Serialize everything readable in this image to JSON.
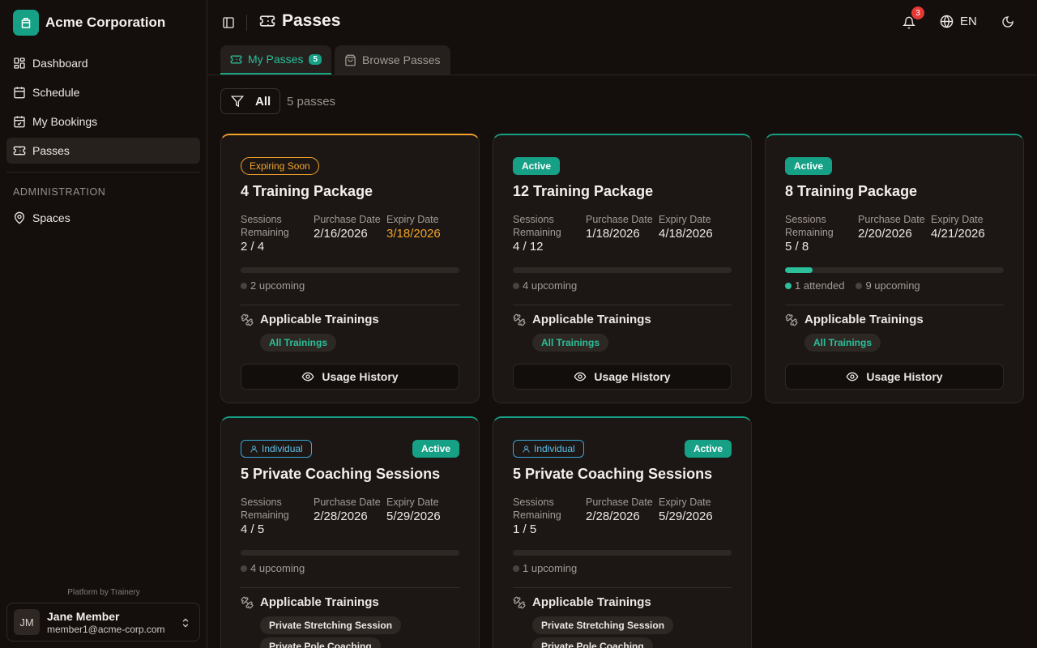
{
  "org": {
    "name": "Acme Corporation"
  },
  "nav": {
    "items": [
      {
        "label": "Dashboard",
        "icon": "dashboard-icon"
      },
      {
        "label": "Schedule",
        "icon": "calendar-icon"
      },
      {
        "label": "My Bookings",
        "icon": "calendar-check-icon"
      },
      {
        "label": "Passes",
        "icon": "ticket-icon",
        "active": true
      }
    ],
    "admin_label": "ADMINISTRATION",
    "admin_items": [
      {
        "label": "Spaces",
        "icon": "map-pin-icon"
      }
    ]
  },
  "footer": {
    "powered": "Platform by Trainery",
    "user_initials": "JM",
    "user_name": "Jane Member",
    "user_email": "member1@acme-corp.com"
  },
  "header": {
    "title": "Passes",
    "notifications": "3",
    "language": "EN"
  },
  "tabs": [
    {
      "label": "My Passes",
      "count": "5",
      "active": true
    },
    {
      "label": "Browse Passes",
      "active": false
    }
  ],
  "filter": {
    "label": "All",
    "count_text": "5 passes"
  },
  "labels": {
    "sessions_remaining": "Sessions Remaining",
    "purchase_date": "Purchase Date",
    "expiry_date": "Expiry Date",
    "applicable_trainings": "Applicable Trainings",
    "usage_history": "Usage History"
  },
  "colors": {
    "accent": "#16a085",
    "warning": "#f2a32a",
    "info": "#3aa5d9",
    "danger": "#e53935"
  },
  "passes": [
    {
      "badge": "Expiring Soon",
      "title": "4 Training Package",
      "sessions": "2 / 4",
      "purchase": "2/16/2026",
      "expiry": "3/18/2026",
      "attended_fraction": 0,
      "upcoming": "2 upcoming",
      "chips": [
        "All Trainings"
      ]
    },
    {
      "badge": "Active",
      "title": "12 Training Package",
      "sessions": "4 / 12",
      "purchase": "1/18/2026",
      "expiry": "4/18/2026",
      "attended_fraction": 0,
      "upcoming": "4 upcoming",
      "chips": [
        "All Trainings"
      ]
    },
    {
      "badge": "Active",
      "title": "8 Training Package",
      "sessions": "5 / 8",
      "purchase": "2/20/2026",
      "expiry": "4/21/2026",
      "attended_fraction": 0.125,
      "attended": "1 attended",
      "upcoming": "9 upcoming",
      "chips": [
        "All Trainings"
      ]
    },
    {
      "type": "Individual",
      "badge": "Active",
      "title": "5 Private Coaching Sessions",
      "sessions": "4 / 5",
      "purchase": "2/28/2026",
      "expiry": "5/29/2026",
      "attended_fraction": 0,
      "upcoming": "4 upcoming",
      "chips": [
        "Private Stretching Session",
        "Private Pole Coaching"
      ]
    },
    {
      "type": "Individual",
      "badge": "Active",
      "title": "5 Private Coaching Sessions",
      "sessions": "1 / 5",
      "purchase": "2/28/2026",
      "expiry": "5/29/2026",
      "attended_fraction": 0,
      "upcoming": "1 upcoming",
      "chips": [
        "Private Stretching Session",
        "Private Pole Coaching"
      ]
    }
  ]
}
